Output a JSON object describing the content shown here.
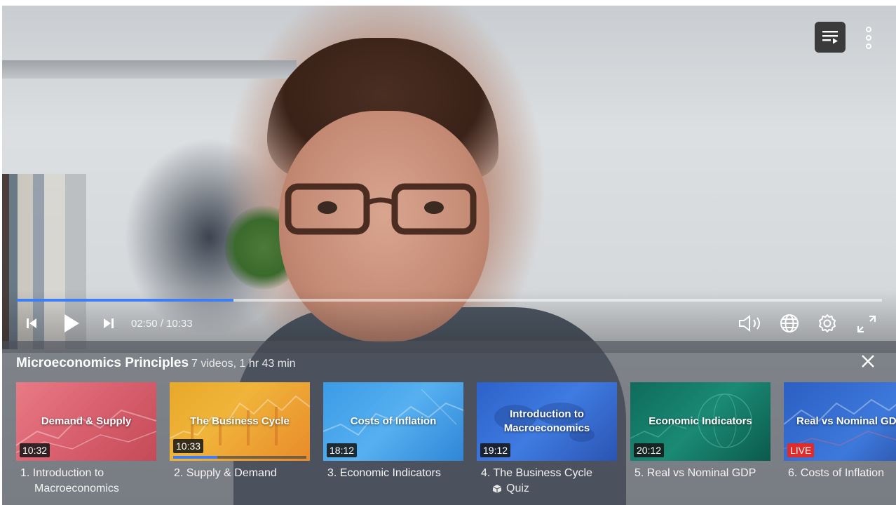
{
  "player": {
    "elapsed": "02:50",
    "duration": "10:33",
    "time_display": "02:50 / 10:33",
    "progress_fraction": 0.25,
    "icons": {
      "previous": "skip-previous-icon",
      "play": "play-icon",
      "next": "skip-next-icon",
      "volume": "volume-icon",
      "language": "globe-icon",
      "settings": "gear-icon",
      "fullscreen": "fullscreen-icon",
      "playlist": "playlist-icon",
      "more": "more-vertical-icon"
    },
    "accent_color": "#3d7df6"
  },
  "playlist": {
    "title": "Microeconomics Principles",
    "meta": "7 videos, 1 hr 43 min",
    "close_icon": "close-icon",
    "items": [
      {
        "thumb_title": "Demand & Supply",
        "badge": "10:32",
        "label_line1": "1. Introduction to",
        "label_line2": "Macroeconomics",
        "sub": "",
        "progress": null
      },
      {
        "thumb_title": "The Business Cycle",
        "badge": "10:33",
        "label_line1": "2. Supply & Demand",
        "label_line2": "",
        "sub": "",
        "progress": 0.33
      },
      {
        "thumb_title": "Costs of Inflation",
        "badge": "18:12",
        "label_line1": "3. Economic Indicators",
        "label_line2": "",
        "sub": "",
        "progress": null
      },
      {
        "thumb_title": "Introduction to Macroeconomics",
        "badge": "19:12",
        "label_line1": "4. The Business Cycle",
        "label_line2": "",
        "sub": "Quiz",
        "progress": null
      },
      {
        "thumb_title": "Economic Indicators",
        "badge": "20:12",
        "label_line1": "5. Real vs Nominal GDP",
        "label_line2": "",
        "sub": "",
        "progress": null
      },
      {
        "thumb_title": "Real vs Nominal GDP",
        "badge": "LIVE",
        "label_line1": "6. Costs of Inflation",
        "label_line2": "",
        "sub": "",
        "progress": null
      }
    ]
  }
}
